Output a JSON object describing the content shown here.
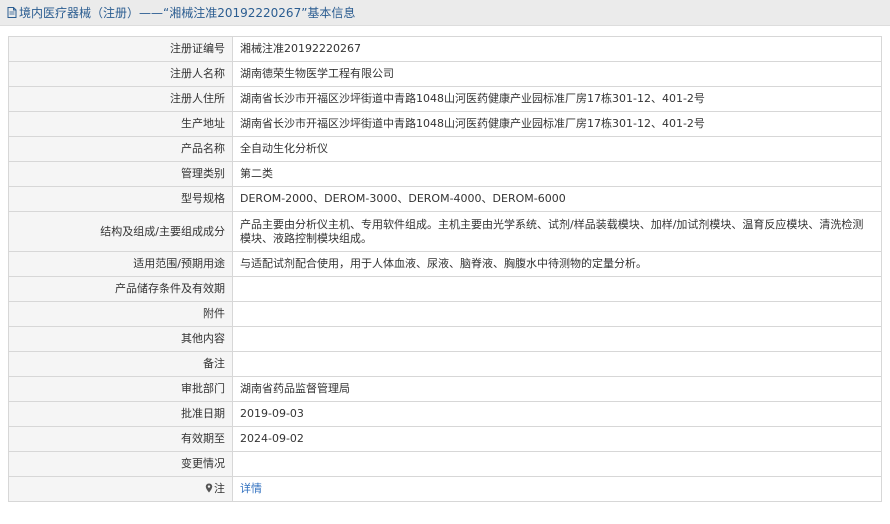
{
  "header": {
    "title": "境内医疗器械（注册）——“湘械注准20192220267”基本信息",
    "icon": "document-icon"
  },
  "rows": [
    {
      "key": "registration_no",
      "label": "注册证编号",
      "value": "湘械注准20192220267"
    },
    {
      "key": "registrant",
      "label": "注册人名称",
      "value": "湖南德荣生物医学工程有限公司"
    },
    {
      "key": "registrant_address",
      "label": "注册人住所",
      "value": "湖南省长沙市开福区沙坪街道中青路1048山河医药健康产业园标准厂房17栋301-12、401-2号"
    },
    {
      "key": "production_address",
      "label": "生产地址",
      "value": "湖南省长沙市开福区沙坪街道中青路1048山河医药健康产业园标准厂房17栋301-12、401-2号"
    },
    {
      "key": "product_name",
      "label": "产品名称",
      "value": "全自动生化分析仪"
    },
    {
      "key": "management_category",
      "label": "管理类别",
      "value": "第二类"
    },
    {
      "key": "model_spec",
      "label": "型号规格",
      "value": "DEROM-2000、DEROM-3000、DEROM-4000、DEROM-6000"
    },
    {
      "key": "structure",
      "label": "结构及组成/主要组成成分",
      "value": "产品主要由分析仪主机、专用软件组成。主机主要由光学系统、试剂/样品装载模块、加样/加试剂模块、温育反应模块、清洗检测模块、液路控制模块组成。"
    },
    {
      "key": "scope",
      "label": "适用范围/预期用途",
      "value": "与适配试剂配合使用，用于人体血液、尿液、脑脊液、胸腹水中待测物的定量分析。"
    },
    {
      "key": "storage",
      "label": "产品储存条件及有效期",
      "value": ""
    },
    {
      "key": "attachment",
      "label": "附件",
      "value": ""
    },
    {
      "key": "other",
      "label": "其他内容",
      "value": ""
    },
    {
      "key": "remark",
      "label": "备注",
      "value": ""
    },
    {
      "key": "approval_dept",
      "label": "审批部门",
      "value": "湖南省药品监督管理局"
    },
    {
      "key": "approval_date",
      "label": "批准日期",
      "value": "2019-09-03"
    },
    {
      "key": "valid_until",
      "label": "有效期至",
      "value": "2024-09-02"
    },
    {
      "key": "changes",
      "label": "变更情况",
      "value": ""
    }
  ],
  "note": {
    "label": "注",
    "icon": "pin-icon",
    "link_text": "详情"
  },
  "colors": {
    "header_text": "#2b5d91",
    "link": "#2f6fbf",
    "label_bg": "#f5f5f5",
    "border": "#d7d7d7"
  }
}
